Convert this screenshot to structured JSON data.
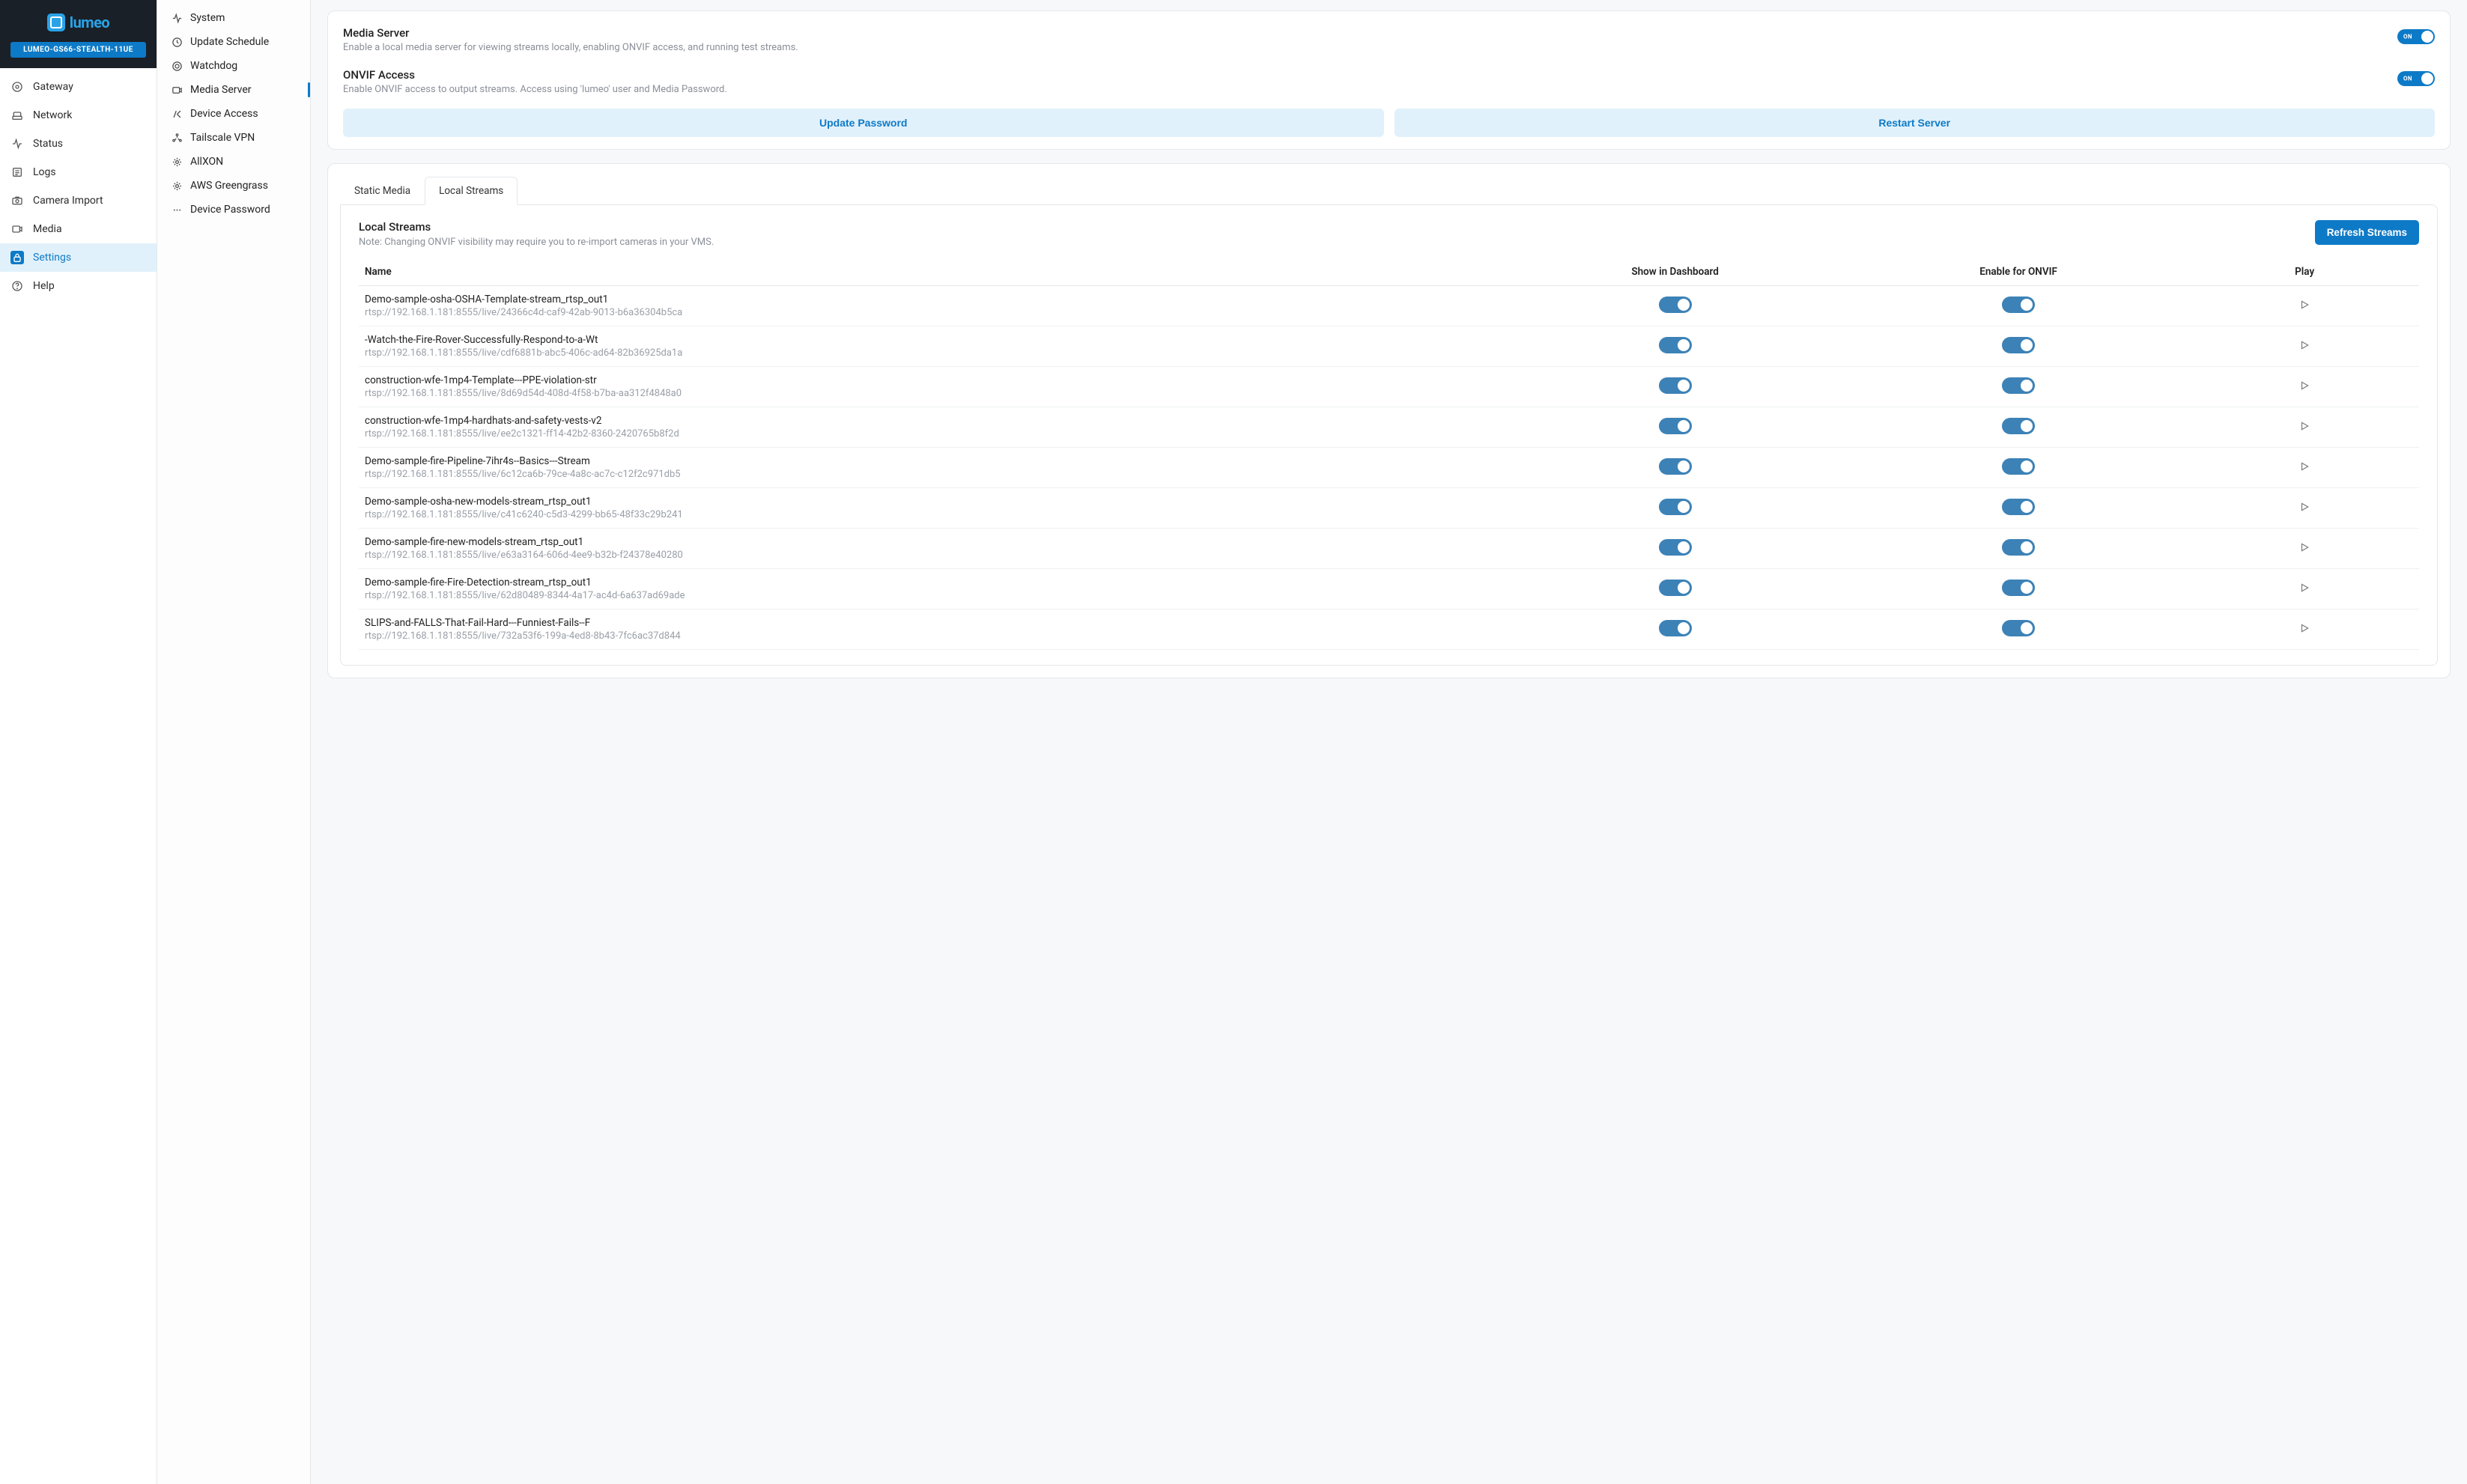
{
  "brand": {
    "name": "lumeo",
    "gateway_id": "LUMEO-GS66-STEALTH-11UE"
  },
  "primary_nav": {
    "items": [
      {
        "key": "gateway",
        "label": "Gateway"
      },
      {
        "key": "network",
        "label": "Network"
      },
      {
        "key": "status",
        "label": "Status"
      },
      {
        "key": "logs",
        "label": "Logs"
      },
      {
        "key": "camera-import",
        "label": "Camera Import"
      },
      {
        "key": "media",
        "label": "Media"
      },
      {
        "key": "settings",
        "label": "Settings"
      },
      {
        "key": "help",
        "label": "Help"
      }
    ],
    "active": "settings"
  },
  "secondary_nav": {
    "items": [
      {
        "key": "system",
        "label": "System"
      },
      {
        "key": "update-schedule",
        "label": "Update Schedule"
      },
      {
        "key": "watchdog",
        "label": "Watchdog"
      },
      {
        "key": "media-server",
        "label": "Media Server"
      },
      {
        "key": "device-access",
        "label": "Device Access"
      },
      {
        "key": "tailscale-vpn",
        "label": "Tailscale VPN"
      },
      {
        "key": "allxon",
        "label": "AllXON"
      },
      {
        "key": "aws-greengrass",
        "label": "AWS Greengrass"
      },
      {
        "key": "device-password",
        "label": "Device Password"
      }
    ],
    "active": "media-server"
  },
  "settings_card": {
    "media_server": {
      "title": "Media Server",
      "desc": "Enable a local media server for viewing streams locally, enabling ONVIF access, and running test streams.",
      "on_label": "ON",
      "enabled": true
    },
    "onvif": {
      "title": "ONVIF Access",
      "desc": "Enable ONVIF access to output streams. Access using 'lumeo' user and Media Password.",
      "on_label": "ON",
      "enabled": true
    },
    "update_password_label": "Update Password",
    "restart_server_label": "Restart Server"
  },
  "tabs": {
    "items": [
      {
        "key": "static-media",
        "label": "Static Media"
      },
      {
        "key": "local-streams",
        "label": "Local Streams"
      }
    ],
    "active": "local-streams"
  },
  "local_streams": {
    "title": "Local Streams",
    "note": "Note: Changing ONVIF visibility may require you to re-import cameras in your VMS.",
    "refresh_label": "Refresh Streams",
    "columns": {
      "name": "Name",
      "dash": "Show in Dashboard",
      "onvif": "Enable for ONVIF",
      "play": "Play"
    },
    "rows": [
      {
        "name": "Demo-sample-osha-OSHA-Template-stream_rtsp_out1",
        "url": "rtsp://192.168.1.181:8555/live/24366c4d-caf9-42ab-9013-b6a36304b5ca",
        "dash": true,
        "onvif": true
      },
      {
        "name": "-Watch-the-Fire-Rover-Successfully-Respond-to-a-Wt",
        "url": "rtsp://192.168.1.181:8555/live/cdf6881b-abc5-406c-ad64-82b36925da1a",
        "dash": true,
        "onvif": true
      },
      {
        "name": "construction-wfe-1mp4-Template---PPE-violation-str",
        "url": "rtsp://192.168.1.181:8555/live/8d69d54d-408d-4f58-b7ba-aa312f4848a0",
        "dash": true,
        "onvif": true
      },
      {
        "name": "construction-wfe-1mp4-hardhats-and-safety-vests-v2",
        "url": "rtsp://192.168.1.181:8555/live/ee2c1321-ff14-42b2-8360-2420765b8f2d",
        "dash": true,
        "onvif": true
      },
      {
        "name": "Demo-sample-fire-Pipeline-7ihr4s--Basics---Stream",
        "url": "rtsp://192.168.1.181:8555/live/6c12ca6b-79ce-4a8c-ac7c-c12f2c971db5",
        "dash": true,
        "onvif": true
      },
      {
        "name": "Demo-sample-osha-new-models-stream_rtsp_out1",
        "url": "rtsp://192.168.1.181:8555/live/c41c6240-c5d3-4299-bb65-48f33c29b241",
        "dash": true,
        "onvif": true
      },
      {
        "name": "Demo-sample-fire-new-models-stream_rtsp_out1",
        "url": "rtsp://192.168.1.181:8555/live/e63a3164-606d-4ee9-b32b-f24378e40280",
        "dash": true,
        "onvif": true
      },
      {
        "name": "Demo-sample-fire-Fire-Detection-stream_rtsp_out1",
        "url": "rtsp://192.168.1.181:8555/live/62d80489-8344-4a17-ac4d-6a637ad69ade",
        "dash": true,
        "onvif": true
      },
      {
        "name": "SLIPS-and-FALLS-That-Fail-Hard---Funniest-Fails--F",
        "url": "rtsp://192.168.1.181:8555/live/732a53f6-199a-4ed8-8b43-7fc6ac37d844",
        "dash": true,
        "onvif": true
      }
    ]
  },
  "colors": {
    "accent": "#0d7ac7",
    "accent_light": "#e1f1fb",
    "header_bg": "#1a2027",
    "muted": "#8a8f98"
  }
}
